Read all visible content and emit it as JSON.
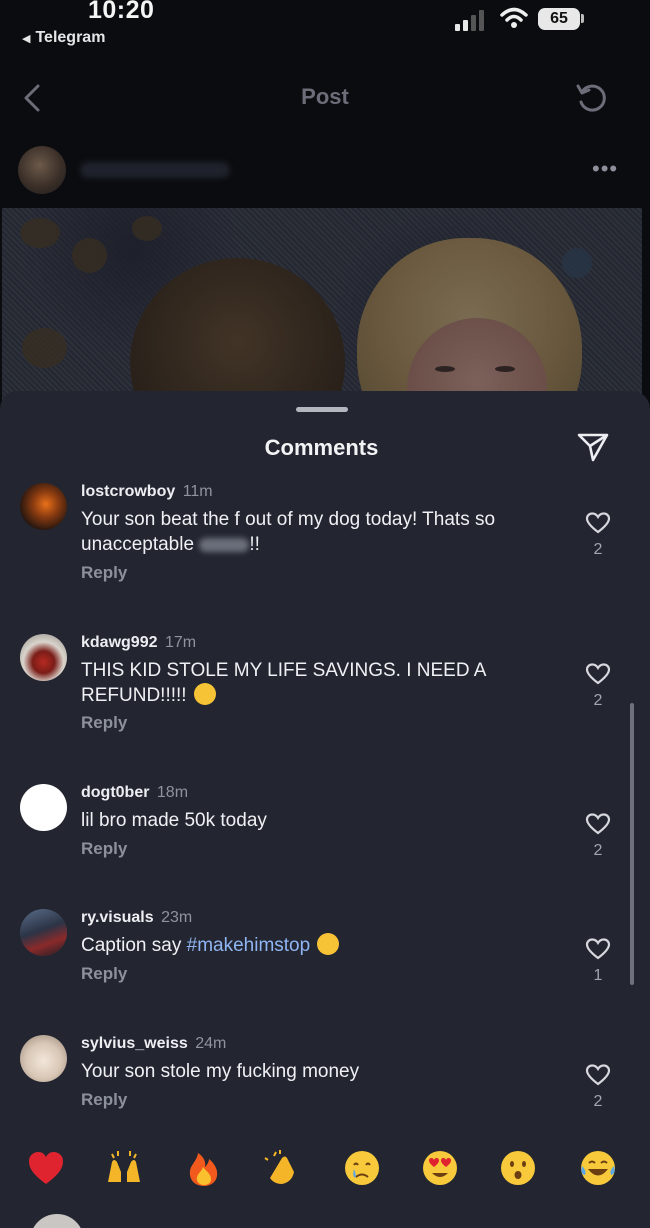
{
  "status_bar": {
    "time": "10:20",
    "back_app": "Telegram",
    "battery": "65",
    "signal_icon": "signal-icon",
    "wifi_icon": "wifi-icon"
  },
  "nav": {
    "title": "Post",
    "back_icon": "chevron-left-icon",
    "refresh_icon": "refresh-icon"
  },
  "post": {
    "more_icon": "more-icon"
  },
  "comments_sheet": {
    "title": "Comments",
    "send_icon": "send-icon",
    "comments": [
      {
        "username": "lostcrowboy",
        "time": "11m",
        "text_before": "Your son beat the f out of my dog today! Thats so unacceptable",
        "text_after": "!!",
        "reply": "Reply",
        "likes": "2"
      },
      {
        "username": "kdawg992",
        "time": "17m",
        "text": "THIS KID STOLE MY LIFE SAVINGS. I NEED A REFUND!!!!!",
        "emoji": "face-with-steam-emoji",
        "reply": "Reply",
        "likes": "2"
      },
      {
        "username": "dogt0ber",
        "time": "18m",
        "text": "lil bro made 50k today",
        "reply": "Reply",
        "likes": "2"
      },
      {
        "username": "ry.visuals",
        "time": "23m",
        "text": "Caption say",
        "hashtag": "#makehimstop",
        "emoji": "crying-laughing-emoji",
        "reply": "Reply",
        "likes": "1"
      },
      {
        "username": "sylvius_weiss",
        "time": "24m",
        "text": "Your son stole my fucking money",
        "reply": "Reply",
        "likes": "2"
      }
    ]
  },
  "emoji_bar": [
    "heart-emoji",
    "raised-hands-emoji",
    "fire-emoji",
    "clapping-emoji",
    "crying-emoji",
    "heart-eyes-emoji",
    "surprised-emoji",
    "laughing-tears-emoji"
  ],
  "colors": {
    "background": "#0b0c10",
    "sheet": "#232631",
    "hashtag": "#8fb5f2"
  }
}
